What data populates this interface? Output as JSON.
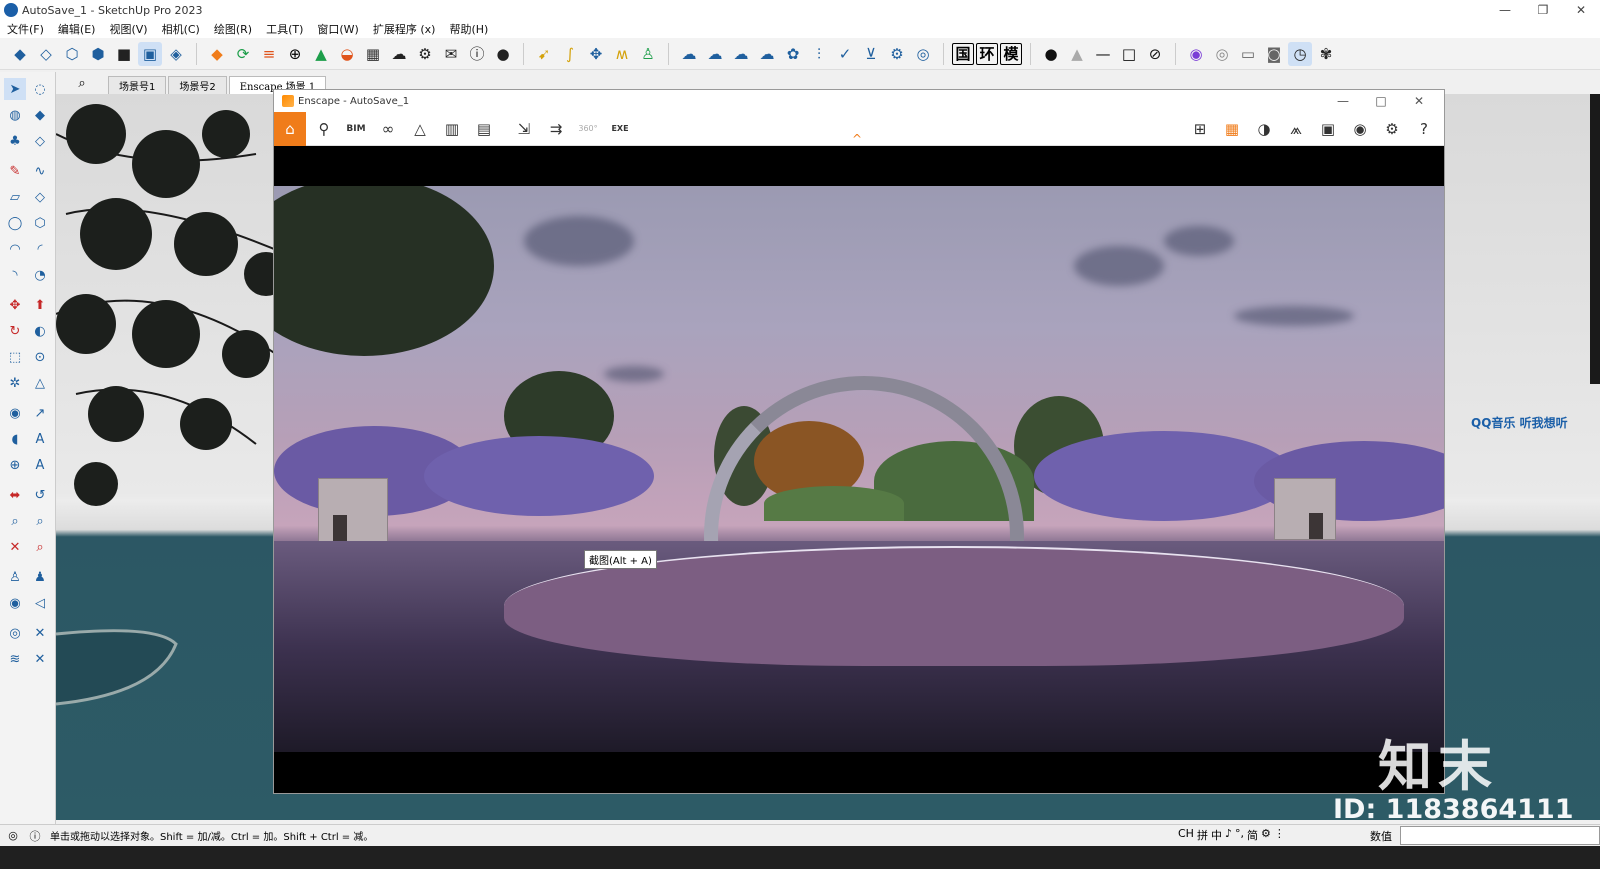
{
  "window": {
    "title": "AutoSave_1 - SketchUp Pro 2023",
    "minimize": "—",
    "restore": "❐",
    "close": "✕"
  },
  "menu": [
    "文件(F)",
    "编辑(E)",
    "视图(V)",
    "相机(C)",
    "绘图(R)",
    "工具(T)",
    "窗口(W)",
    "扩展程序 (x)",
    "帮助(H)"
  ],
  "toolbar": {
    "text_buttons": [
      "国",
      "环",
      "模"
    ]
  },
  "scene_tabs": [
    "场景号1",
    "场景号2",
    "Enscape 场景 1"
  ],
  "enscape": {
    "title": "Enscape - AutoSave_1",
    "tooltip": "截图(Alt + A)",
    "accent": "#f07c1a",
    "tools_left": [
      "home-icon",
      "pin-icon",
      "bim-icon",
      "binoculars-icon",
      "triangle-icon",
      "building-icon",
      "clapper-icon",
      "export-image-icon",
      "batch-render-icon",
      "panorama-icon",
      "exe-export-icon"
    ],
    "tools_right": [
      "map-icon",
      "asset-library-icon",
      "material-icon",
      "site-icon",
      "vr-headset-icon",
      "eye-icon",
      "settings-icon",
      "help-icon"
    ],
    "bim_label": "BIM",
    "pano_label": "360°",
    "exe_label": "EXE"
  },
  "overlay_text": "QQ音乐 听我想听",
  "status": {
    "hint": "单击或拖动以选择对象。Shift = 加/减。Ctrl = 加。Shift + Ctrl = 减。",
    "ime": [
      "CH",
      "拼",
      "中",
      "♪",
      "°,",
      "简",
      "⚙",
      "⋮"
    ],
    "measurements_label": "数值"
  },
  "brand": {
    "logo_text": "知末",
    "id_text": "ID: 1183864111"
  }
}
